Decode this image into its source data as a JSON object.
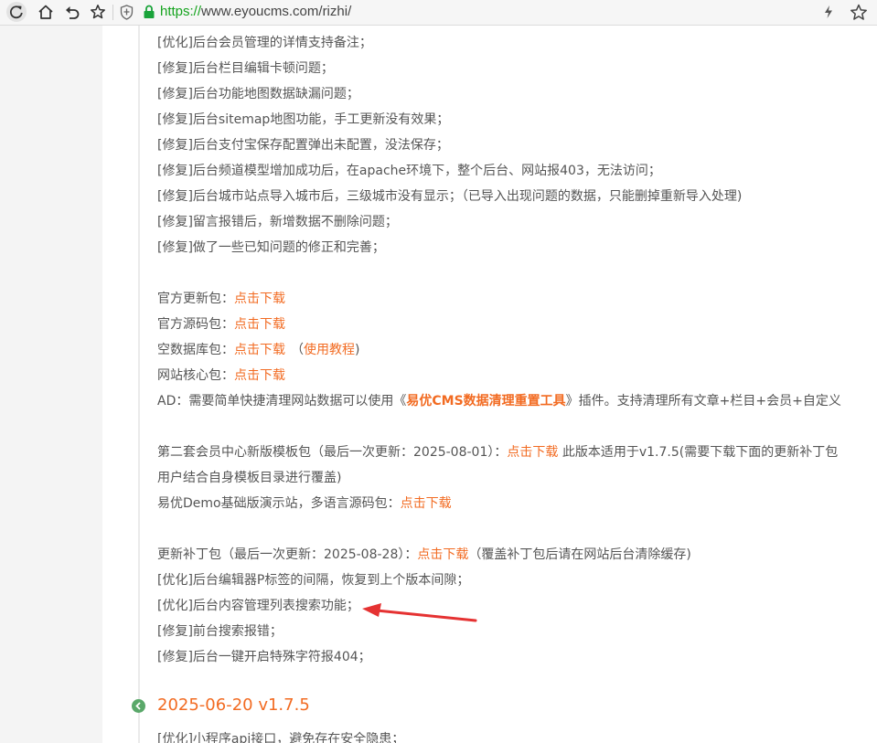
{
  "browser": {
    "url_scheme": "https://",
    "url_rest": "www.eyoucms.com/rizhi/"
  },
  "changelog": {
    "fixes": [
      "[优化]后台会员管理的详情支持备注；",
      "[修复]后台栏目编辑卡顿问题；",
      "[修复]后台功能地图数据缺漏问题；",
      "[修复]后台sitemap地图功能，手工更新没有效果；",
      "[修复]后台支付宝保存配置弹出未配置，没法保存；",
      "[修复]后台频道模型增加成功后，在apache环境下，整个后台、网站报403，无法访问；",
      "[修复]后台城市站点导入城市后，三级城市没有显示；（已导入出现问题的数据，只能删掉重新导入处理)",
      "[修复]留言报错后，新增数据不删除问题；",
      "[修复]做了一些已知问题的修正和完善；"
    ],
    "downloads": {
      "official_update_label": "官方更新包：",
      "official_source_label": "官方源码包：",
      "empty_db_label": "空数据库包：",
      "core_label": "网站核心包：",
      "download_link": "点击下载",
      "tutorial_open": "（",
      "tutorial_link": "使用教程",
      "tutorial_close": ")"
    },
    "ad": {
      "prefix": "AD：需要简单快捷清理网站数据可以使用《",
      "tool_name": "易优CMS数据清理重置工具",
      "suffix": "》插件。支持清理所有文章+栏目+会员+自定义"
    },
    "member_template": {
      "prefix": "第二套会员中心新版模板包（最后一次更新：2025-08-01）：",
      "link": "点击下载",
      "suffix": "  此版本适用于v1.7.5(需要下载下面的更新补丁包",
      "line2": "用户结合自身模板目录进行覆盖)"
    },
    "demo": {
      "prefix": "易优Demo基础版演示站，多语言源码包：",
      "link": "点击下载"
    },
    "patch": {
      "prefix": "更新补丁包（最后一次更新：2025-08-28）：",
      "link": "点击下载",
      "suffix": "（覆盖补丁包后请在网站后台清除缓存)",
      "items": [
        "[优化]后台编辑器P标签的间隔，恢复到上个版本间隙；",
        "[优化]后台内容管理列表搜索功能；",
        "[修复]前台搜索报错；",
        "[修复]后台一键开启特殊字符报404；"
      ]
    },
    "next_version": {
      "title": "2025-06-20 v1.7.5",
      "first_item": "[优化]小程序api接口，避免存在安全隐患；"
    }
  }
}
